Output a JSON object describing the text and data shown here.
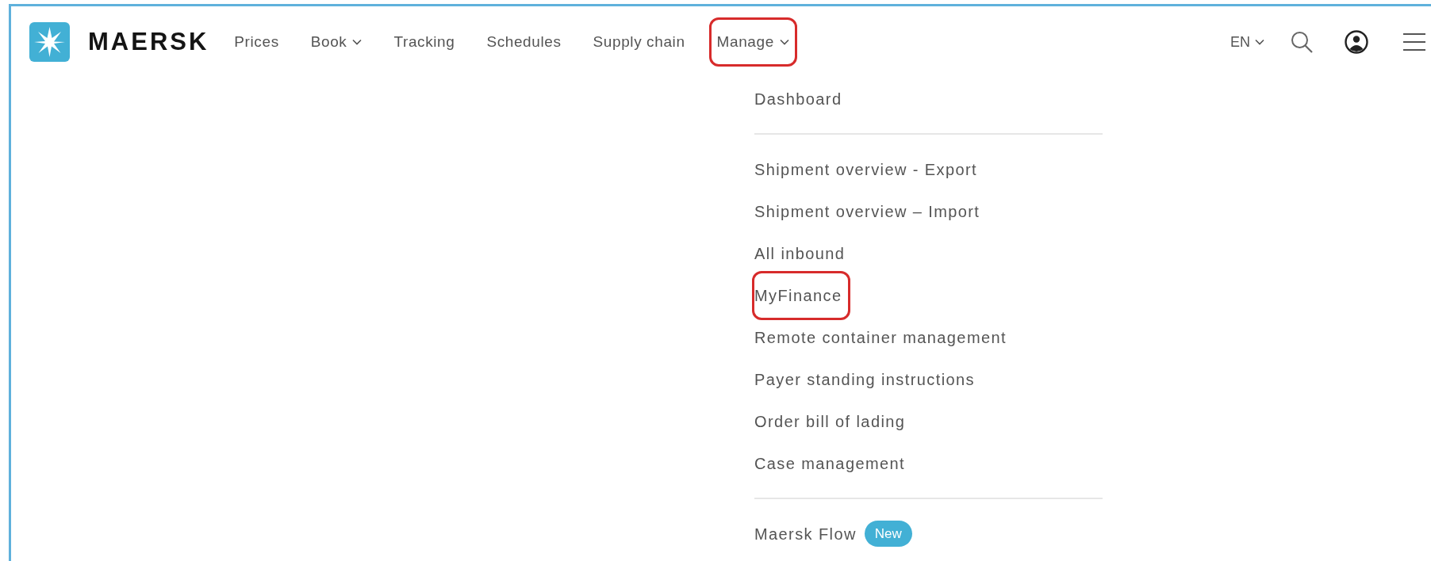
{
  "header": {
    "brand": "MAERSK",
    "nav": [
      {
        "label": "Prices",
        "has_caret": false,
        "highlighted": false
      },
      {
        "label": "Book",
        "has_caret": true,
        "highlighted": false
      },
      {
        "label": "Tracking",
        "has_caret": false,
        "highlighted": false
      },
      {
        "label": "Schedules",
        "has_caret": false,
        "highlighted": false
      },
      {
        "label": "Supply chain",
        "has_caret": false,
        "highlighted": false
      },
      {
        "label": "Manage",
        "has_caret": true,
        "highlighted": true
      }
    ],
    "language": "EN"
  },
  "dropdown": {
    "sections": [
      {
        "items": [
          {
            "label": "Dashboard",
            "highlighted": false
          }
        ]
      },
      {
        "items": [
          {
            "label": "Shipment overview - Export",
            "highlighted": false
          },
          {
            "label": "Shipment overview – Import",
            "highlighted": false
          },
          {
            "label": "All inbound",
            "highlighted": false
          },
          {
            "label": "MyFinance",
            "highlighted": true
          },
          {
            "label": "Remote container management",
            "highlighted": false
          },
          {
            "label": "Payer standing instructions",
            "highlighted": false
          },
          {
            "label": "Order bill of lading",
            "highlighted": false
          },
          {
            "label": "Case management",
            "highlighted": false
          }
        ]
      },
      {
        "items": [
          {
            "label": "Maersk Flow",
            "highlighted": false,
            "badge": "New"
          }
        ]
      }
    ]
  }
}
